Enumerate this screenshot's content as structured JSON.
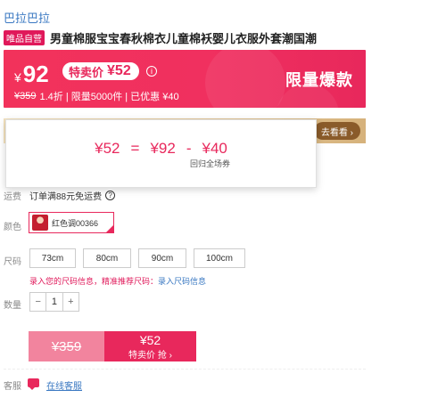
{
  "brand": "巴拉巴拉",
  "product": {
    "badge": "唯品自营",
    "title": "男童棉服宝宝春秋棉衣儿童棉袄婴儿衣服外套潮国潮"
  },
  "price_banner": {
    "currency": "¥",
    "price": "92",
    "special_label": "特卖价",
    "special_price": "¥52",
    "info_icon": "info-icon",
    "original_price": "¥359",
    "details": "1.4折 | 限量5000件 | 已优惠 ¥40",
    "badge": "限量爆款",
    "colors": {
      "primary": "#f2325b",
      "accent": "#e8285c"
    }
  },
  "gold_strip": {
    "button": "去看看 ›"
  },
  "popup": {
    "final": "¥52",
    "eq": "=",
    "price": "¥92",
    "minus": "-",
    "discount": "¥40",
    "note": "回归全场券"
  },
  "labels": {
    "shipping": "运费",
    "color": "颜色",
    "size": "尺码",
    "qty": "数量",
    "service": "客服"
  },
  "shipping": {
    "text": "订单满88元免运费",
    "help_icon": "?"
  },
  "color_option": {
    "label": "红色调00366",
    "selected": true
  },
  "sizes": [
    "73cm",
    "80cm",
    "90cm",
    "100cm"
  ],
  "size_hint": {
    "text": "录入您的尺码信息，精准推荐尺码：",
    "link": "录入尺码信息"
  },
  "quantity": {
    "minus": "−",
    "value": "1",
    "plus": "+"
  },
  "buy_button": {
    "original": "¥359",
    "price": "¥52",
    "label": "特卖价 抢 ›"
  },
  "service_link": "在线客服"
}
